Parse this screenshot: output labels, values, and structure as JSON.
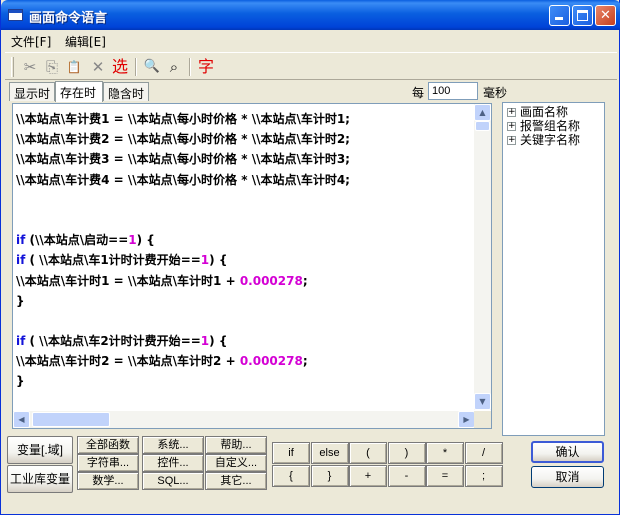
{
  "window": {
    "title": "画面命令语言"
  },
  "menu": [
    {
      "label": "文件[F]"
    },
    {
      "label": "编辑[E]"
    }
  ],
  "toolbar": {
    "cut_icon": "✂",
    "copy_icon": "⎘",
    "paste_icon": "📋",
    "delete_icon": "✕",
    "select_label": "选",
    "find_icon": "🔍",
    "replace_icon": "⌕",
    "font_label": "字"
  },
  "tabs": [
    {
      "label": "显示时"
    },
    {
      "label": "存在时"
    },
    {
      "label": "隐含时"
    }
  ],
  "interval": {
    "label": "每",
    "value": "100",
    "unit": "毫秒"
  },
  "code_lines": [
    "\\\\本站点\\车计费1 = \\\\本站点\\每小时价格 * \\\\本站点\\车计时1;",
    "\\\\本站点\\车计费2 = \\\\本站点\\每小时价格 * \\\\本站点\\车计时2;",
    "\\\\本站点\\车计费3 = \\\\本站点\\每小时价格 * \\\\本站点\\车计时3;",
    "\\\\本站点\\车计费4 = \\\\本站点\\每小时价格 * \\\\本站点\\车计时4;",
    "",
    "",
    "if (\\\\本站点\\启动==1) {",
    "if ( \\\\本站点\\车1计时计费开始==1) {",
    "\\\\本站点\\车计时1 = \\\\本站点\\车计时1 + 0.000278;",
    "}",
    "",
    "if ( \\\\本站点\\车2计时计费开始==1) {",
    "\\\\本站点\\车计时2 = \\\\本站点\\车计时2 + 0.000278;",
    "}"
  ],
  "tree": [
    {
      "label": "画面名称"
    },
    {
      "label": "报警组名称"
    },
    {
      "label": "关键字名称"
    }
  ],
  "var_buttons": {
    "domain": "变量[.域]",
    "library": "工业库变量"
  },
  "func_buttons": [
    {
      "label": "全部函数"
    },
    {
      "label": "系统..."
    },
    {
      "label": "帮助..."
    },
    {
      "label": "字符串..."
    },
    {
      "label": "控件..."
    },
    {
      "label": "自定义..."
    },
    {
      "label": "数学..."
    },
    {
      "label": "SQL..."
    },
    {
      "label": "其它..."
    }
  ],
  "op_buttons": [
    {
      "label": "if"
    },
    {
      "label": "else"
    },
    {
      "label": "("
    },
    {
      "label": ")"
    },
    {
      "label": "*"
    },
    {
      "label": "/"
    },
    {
      "label": "{"
    },
    {
      "label": "}"
    },
    {
      "label": "+"
    },
    {
      "label": "-"
    },
    {
      "label": "="
    },
    {
      "label": ";"
    }
  ],
  "dialog": {
    "ok": "确认",
    "cancel": "取消"
  },
  "colors": {
    "keyword": "#1414d9",
    "number": "#d400d4",
    "titlebar": "#0a5fe0"
  }
}
